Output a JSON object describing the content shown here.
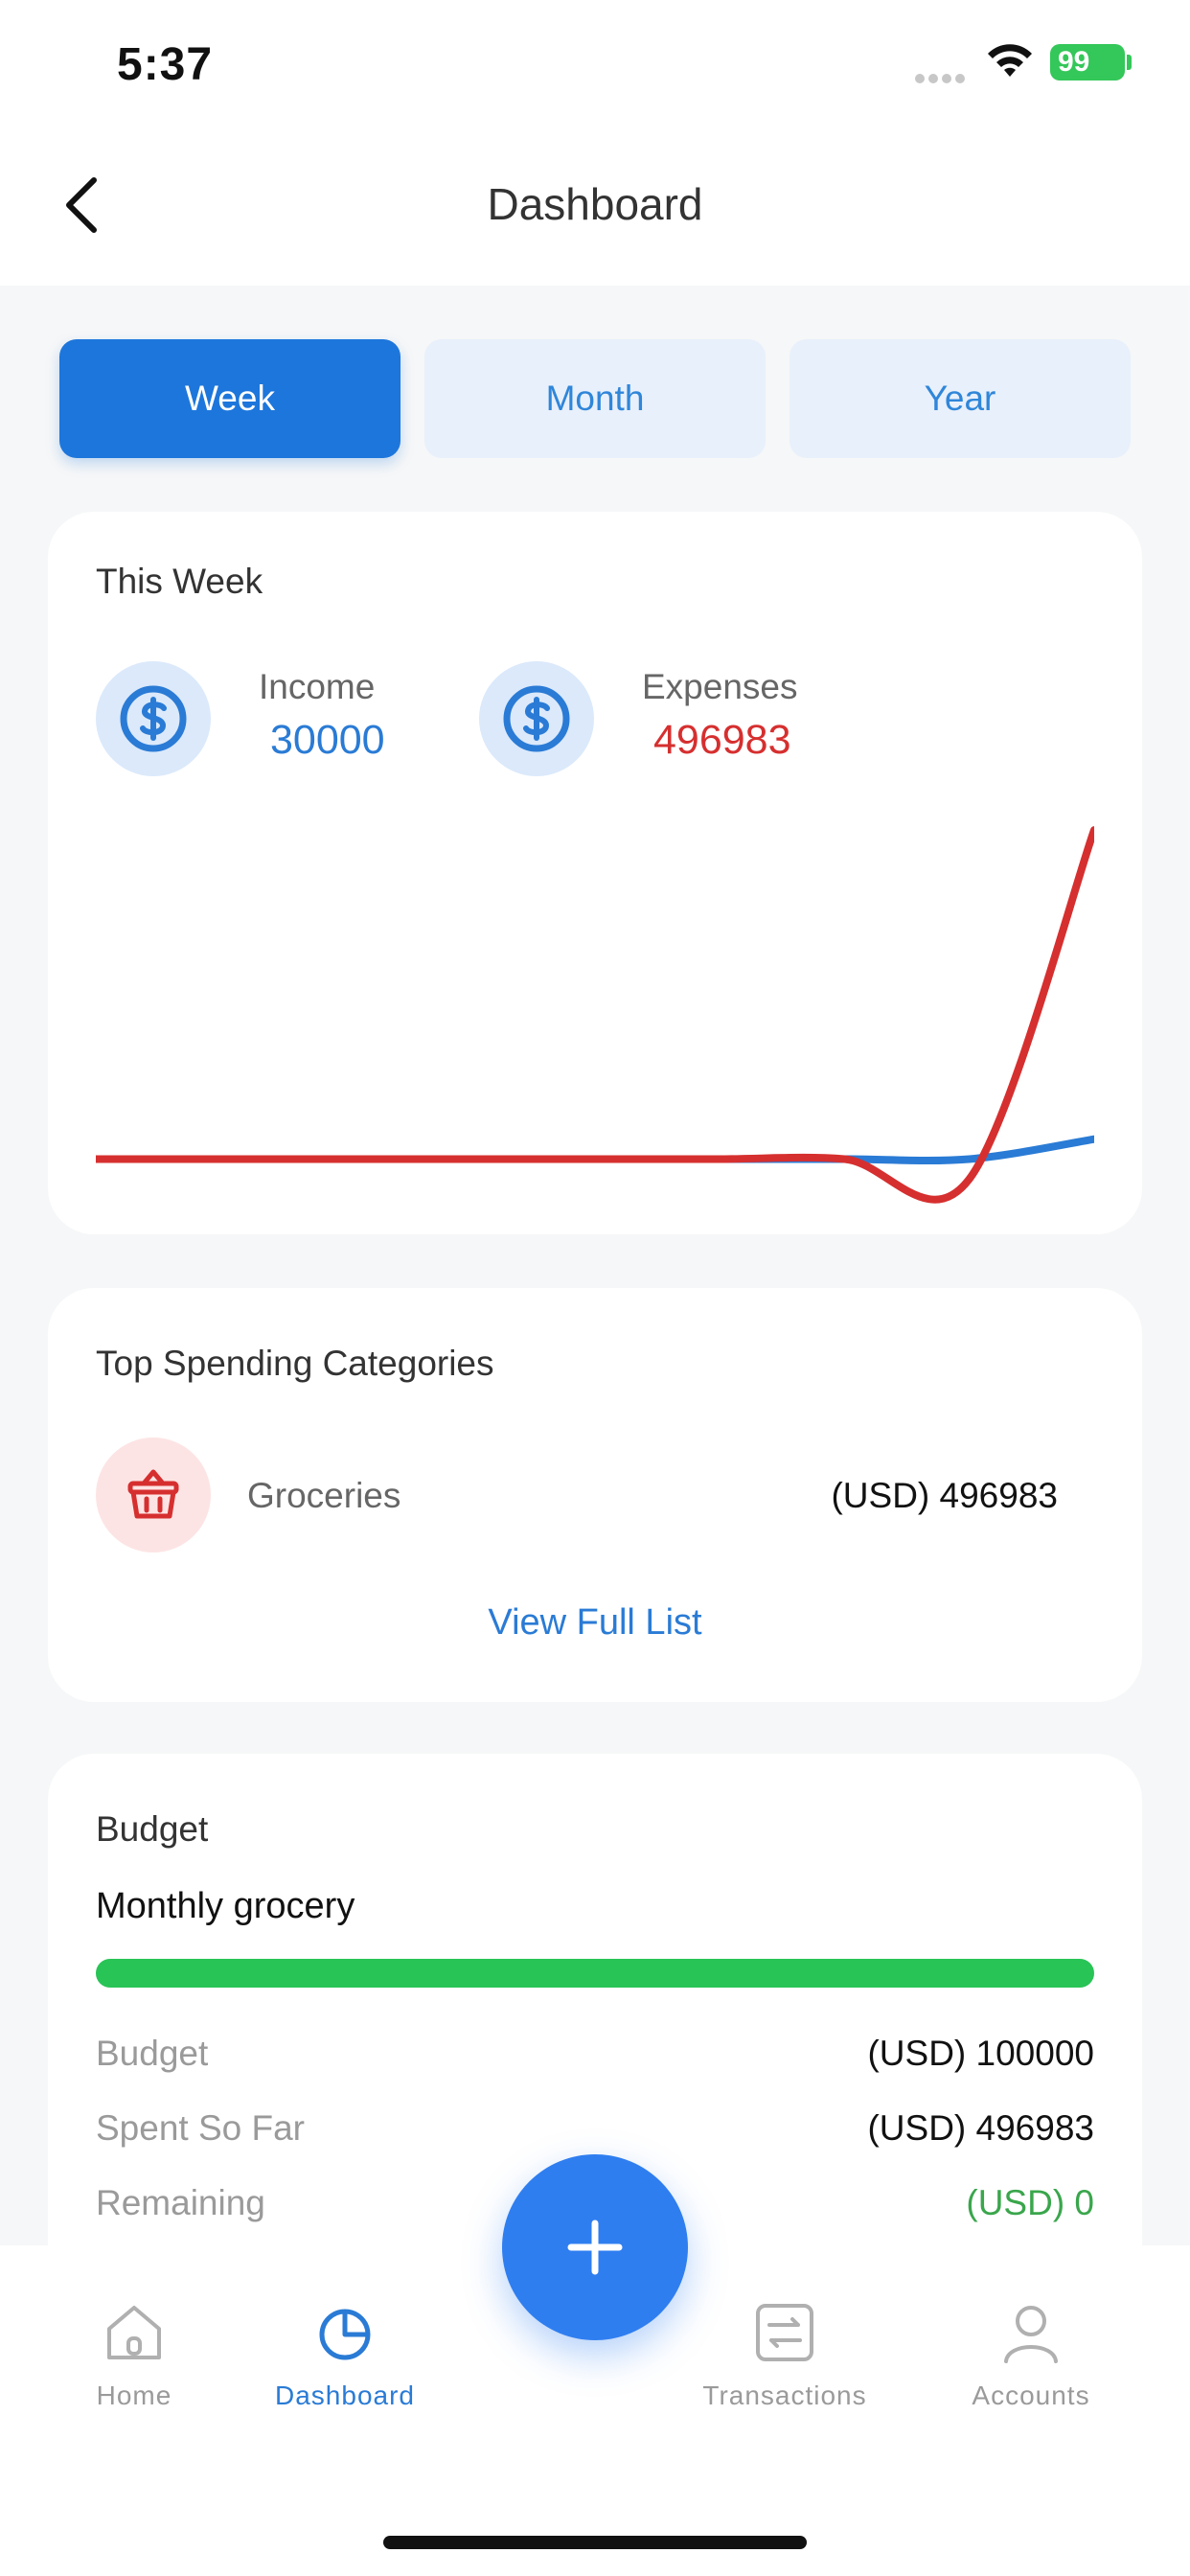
{
  "status_bar": {
    "time": "5:37",
    "battery": "99"
  },
  "header": {
    "title": "Dashboard"
  },
  "tabs": [
    {
      "label": "Week",
      "active": true
    },
    {
      "label": "Month",
      "active": false
    },
    {
      "label": "Year",
      "active": false
    }
  ],
  "summary": {
    "title": "This Week",
    "income": {
      "label": "Income",
      "value": "30000",
      "color": "#2a7bd5",
      "icon": "dollar-icon"
    },
    "expenses": {
      "label": "Expenses",
      "value": "496983",
      "color": "#d62f2f",
      "icon": "dollar-icon"
    }
  },
  "chart_data": {
    "type": "line",
    "series": [
      {
        "name": "Income",
        "color": "#2a7bd5",
        "values": [
          0,
          0,
          0,
          0,
          0,
          0,
          0,
          0,
          30000
        ]
      },
      {
        "name": "Expenses",
        "color": "#d62f2f",
        "values": [
          0,
          0,
          0,
          0,
          0,
          0,
          0,
          -30000,
          496983
        ]
      }
    ],
    "ylim": [
      -50000,
      500000
    ],
    "grid": false
  },
  "top_spending": {
    "title": "Top Spending Categories",
    "items": [
      {
        "name": "Groceries",
        "amount": "(USD) 496983",
        "icon": "basket-icon"
      }
    ],
    "link_label": "View Full List"
  },
  "budget": {
    "title": "Budget",
    "name": "Monthly grocery",
    "progress": 1.0,
    "rows": [
      {
        "label": "Budget",
        "value": "(USD) 100000"
      },
      {
        "label": "Spent So Far",
        "value": "(USD) 496983"
      },
      {
        "label": "Remaining",
        "value": "(USD) 0",
        "color": "#3aa64c"
      }
    ]
  },
  "nav": {
    "items": [
      {
        "label": "Home",
        "icon": "home-icon",
        "active": false
      },
      {
        "label": "Dashboard",
        "icon": "pie-chart-icon",
        "active": true
      },
      {
        "label": "Transactions",
        "icon": "transfer-icon",
        "active": false
      },
      {
        "label": "Accounts",
        "icon": "user-icon",
        "active": false
      }
    ],
    "fab_icon": "plus-icon"
  }
}
